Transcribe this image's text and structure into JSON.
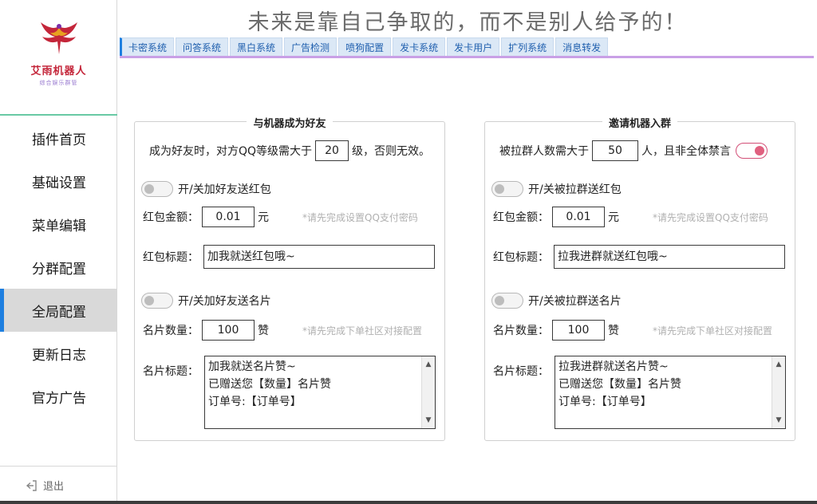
{
  "app": {
    "logo_name": "艾雨机器人",
    "logo_sub": "综合娱乐群管",
    "motto": "未来是靠自己争取的，而不是别人给予的！"
  },
  "sidebar": {
    "items": [
      {
        "label": "插件首页"
      },
      {
        "label": "基础设置"
      },
      {
        "label": "菜单编辑"
      },
      {
        "label": "分群配置"
      },
      {
        "label": "全局配置"
      },
      {
        "label": "更新日志"
      },
      {
        "label": "官方广告"
      }
    ],
    "active": "全局配置",
    "logout_label": "退出"
  },
  "tabs": [
    "卡密系统",
    "问答系统",
    "黑白系统",
    "广告检测",
    "喷狗配置",
    "发卡系统",
    "发卡用户",
    "扩列系统",
    "消息转发"
  ],
  "friend_panel": {
    "title": "与机器成为好友",
    "level_prefix": "成为好友时，对方QQ等级需大于",
    "level_value": "20",
    "level_suffix": "级，否则无效。",
    "redpacket_toggle_label": "开/关加好友送红包",
    "amount_label": "红包金额：",
    "amount_value": "0.01",
    "amount_unit": "元",
    "amount_hint": "*请先完成设置QQ支付密码",
    "rp_title_label": "红包标题：",
    "rp_title_value": "加我就送红包哦~",
    "card_toggle_label": "开/关加好友送名片",
    "card_count_label": "名片数量：",
    "card_count_value": "100",
    "card_count_unit": "赞",
    "card_hint": "*请先完成下单社区对接配置",
    "card_title_label": "名片标题：",
    "card_title_lines": [
      "加我就送名片赞~",
      "已赠送您【数量】名片赞",
      "订单号:【订单号】"
    ]
  },
  "group_panel": {
    "title": "邀请机器入群",
    "count_prefix": "被拉群人数需大于",
    "count_value": "50",
    "count_suffix": "人，且非全体禁言",
    "redpacket_toggle_label": "开/关被拉群送红包",
    "amount_label": "红包金额：",
    "amount_value": "0.01",
    "amount_unit": "元",
    "amount_hint": "*请先完成设置QQ支付密码",
    "rp_title_label": "红包标题：",
    "rp_title_value": "拉我进群就送红包哦~",
    "card_toggle_label": "开/关被拉群送名片",
    "card_count_label": "名片数量：",
    "card_count_value": "100",
    "card_count_unit": "赞",
    "card_hint": "*请先完成下单社区对接配置",
    "card_title_label": "名片标题：",
    "card_title_lines": [
      "拉我进群就送名片赞~",
      "已赠送您【数量】名片赞",
      "订单号:【订单号】"
    ]
  },
  "colors": {
    "accent": "#1e7fe0",
    "tab_bg": "#dbe8f6",
    "tab_underline": "#c9a0e6",
    "toggle_on": "#e0607f",
    "logo_red": "#c4263a"
  }
}
